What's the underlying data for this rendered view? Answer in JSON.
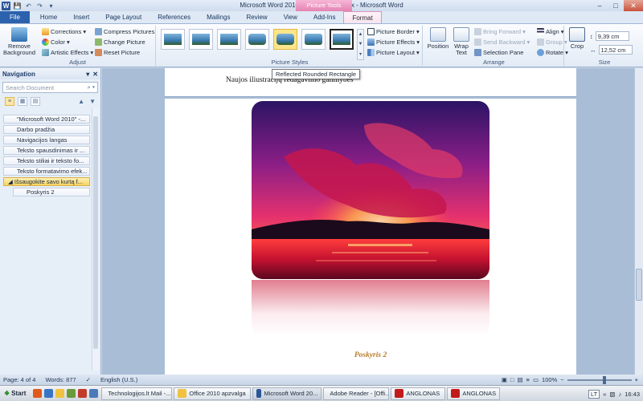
{
  "window": {
    "title": "Microsoft Word 2010_apzvalga_01.docx - Microsoft Word",
    "context_tab": "Picture Tools"
  },
  "tabs": [
    {
      "label": "File"
    },
    {
      "label": "Home"
    },
    {
      "label": "Insert"
    },
    {
      "label": "Page Layout"
    },
    {
      "label": "References"
    },
    {
      "label": "Mailings"
    },
    {
      "label": "Review"
    },
    {
      "label": "View"
    },
    {
      "label": "Add-Ins"
    },
    {
      "label": "Format"
    }
  ],
  "ribbon": {
    "adjust": {
      "remove_background": "Remove Background",
      "corrections": "Corrections",
      "color": "Color",
      "artistic_effects": "Artistic Effects",
      "compress_pictures": "Compress Pictures",
      "change_picture": "Change Picture",
      "reset_picture": "Reset Picture",
      "label": "Adjust"
    },
    "picture_styles": {
      "label": "Picture Styles",
      "picture_border": "Picture Border",
      "picture_effects": "Picture Effects",
      "picture_layout": "Picture Layout"
    },
    "arrange": {
      "label": "Arrange",
      "position": "Position",
      "wrap_text": "Wrap Text",
      "bring_forward": "Bring Forward",
      "send_backward": "Send Backward",
      "selection_pane": "Selection Pane",
      "align": "Align",
      "group": "Group",
      "rotate": "Rotate"
    },
    "size": {
      "label": "Size",
      "crop": "Crop",
      "height": "9,39 cm",
      "width": "12,52 cm"
    }
  },
  "tooltip": "Reflected Rounded Rectangle",
  "navigation": {
    "title": "Navigation",
    "search_placeholder": "Search Document",
    "items": [
      {
        "label": "\"Microsoft Word 2010\" -..."
      },
      {
        "label": "Darbo pradžia"
      },
      {
        "label": "Navigacijos langas"
      },
      {
        "label": "Teksto spausdinimas ir ..."
      },
      {
        "label": "Teksto stiliai ir teksto fo..."
      },
      {
        "label": "Teksto formatavimo efek..."
      },
      {
        "label": "Išsaugokite savo kurtą f..."
      },
      {
        "label": "Poskyris 2"
      }
    ]
  },
  "document": {
    "heading": "Naujos iliustracijų redagavimo galimybės",
    "caption": "Poskyris 2"
  },
  "status": {
    "page": "Page: 4 of 4",
    "words": "Words: 877",
    "language": "English (U.S.)",
    "zoom": "100%"
  },
  "taskbar": {
    "start": "Start",
    "tasks": [
      {
        "label": "Technologijos.lt Mail -..."
      },
      {
        "label": "Office 2010 apzvalga"
      },
      {
        "label": "Microsoft Word 20..."
      },
      {
        "label": "Adobe Reader - [Offi..."
      },
      {
        "label": "ANGLONAS"
      },
      {
        "label": "ANGLONAS"
      }
    ],
    "lang": "LT",
    "time": "16:43"
  }
}
